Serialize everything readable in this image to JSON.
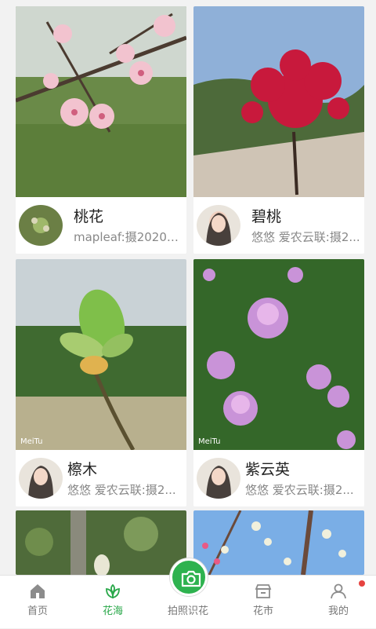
{
  "feed": {
    "cards": [
      {
        "title": "桃花",
        "subtitle": "mapleaf:摄20200...",
        "photo": "peach-blossom",
        "avatar": "flower-bud"
      },
      {
        "title": "碧桃",
        "subtitle": "悠悠 爱农云联:摄2...",
        "photo": "red-flowering-tree",
        "avatar": "woman-portrait"
      },
      {
        "title": "檫木",
        "subtitle": "悠悠 爱农云联:摄2...",
        "photo": "sassafras-bud",
        "avatar": "woman-portrait"
      },
      {
        "title": "紫云英",
        "subtitle": "悠悠 爱农云联:摄2...",
        "photo": "purple-clover-flowers",
        "avatar": "woman-portrait"
      }
    ],
    "watermark": "MeiTu"
  },
  "tabbar": {
    "home": "首页",
    "flower_sea": "花海",
    "identify": "拍照识花",
    "market": "花市",
    "mine": "我的",
    "active_tab": "花海"
  },
  "colors": {
    "accent": "#2aa84a",
    "badge": "#e64340"
  }
}
